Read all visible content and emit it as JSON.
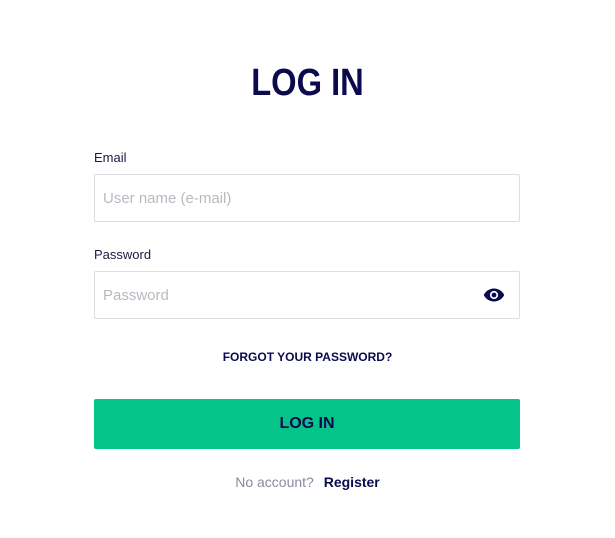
{
  "login_form": {
    "title": "LOG IN",
    "email": {
      "label": "Email",
      "value": "",
      "placeholder": "User name (e-mail)"
    },
    "password": {
      "label": "Password",
      "value": "",
      "placeholder": "Password",
      "visibility_icon": "eye-icon"
    },
    "forgot_password_link": "FORGOT YOUR PASSWORD?",
    "submit_label": "LOG IN",
    "footer": {
      "prompt": "No account?",
      "register_link": "Register"
    }
  },
  "colors": {
    "brand_navy": "#0c0a4e",
    "accent_green": "#05c489",
    "field_border": "#dcdce2",
    "placeholder": "#b9b9c2",
    "muted_text": "#8a8aa0"
  }
}
